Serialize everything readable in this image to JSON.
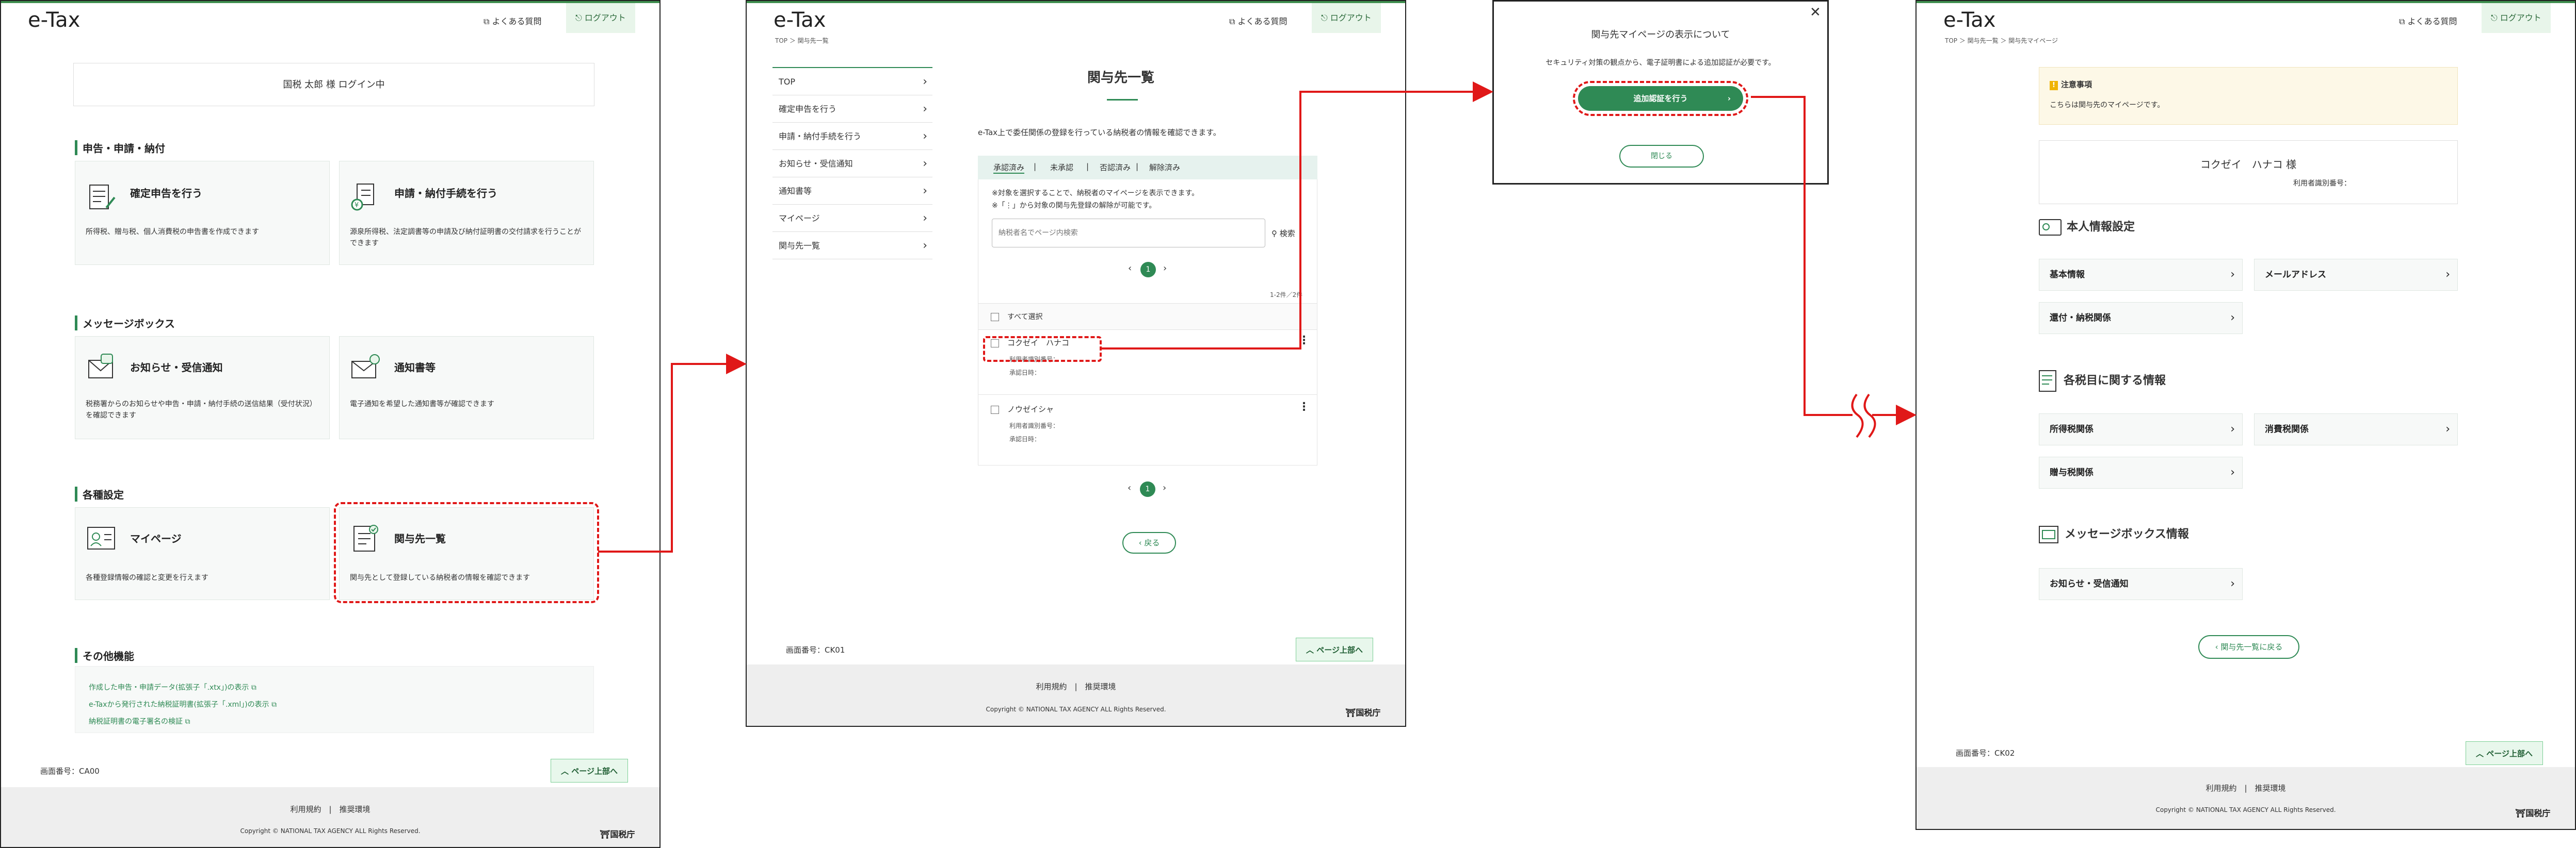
{
  "colors": {
    "accent": "#2f8a55",
    "arrow": "#e01818",
    "brand_top": "#3f8f4f"
  },
  "common": {
    "logo": "e-Tax",
    "faq": "よくある質問",
    "logout": "ログアウト",
    "footer_terms": "利用規約",
    "footer_sep": "|",
    "footer_env": "推奨環境",
    "copyright": "Copyright © NATIONAL TAX AGENCY ALL Rights Reserved.",
    "agency": "国税庁",
    "page_top": "ページ上部へ"
  },
  "screen1": {
    "login_user": "国税 太郎 様 ログイン中",
    "sec_filing": "申告・申請・納付",
    "card_kakutei_title": "確定申告を行う",
    "card_kakutei_desc": "所得税、贈与税、個人消費税の申告書を作成できます",
    "card_shinsei_title": "申請・納付手続を行う",
    "card_shinsei_desc": "源泉所得税、法定調書等の申請及び納付証明書の交付請求を行うことができます",
    "sec_message": "メッセージボックス",
    "card_oshirase_title": "お知らせ・受信通知",
    "card_oshirase_desc": "税務署からのお知らせや申告・申請・納付手続の送信結果（受付状況）を確認できます",
    "card_tsuchi_title": "通知書等",
    "card_tsuchi_desc": "電子通知を希望した通知書等が確認できます",
    "sec_settings": "各種設定",
    "card_mypage_title": "マイページ",
    "card_mypage_desc": "各種登録情報の確認と変更を行えます",
    "card_kanyo_title": "関与先一覧",
    "card_kanyo_desc": "関与先として登録している納税者の情報を確認できます",
    "sec_other": "その他機能",
    "link1": "作成した申告・申請データ(拡張子「.xtx」)の表示",
    "link2": "e-Taxから発行された納税証明書(拡張子「.xml」)の表示",
    "link3": "納税証明書の電子署名の検証",
    "screen_no": "画面番号：CA00"
  },
  "screen2": {
    "breadcrumb": "TOP ＞ 関与先一覧",
    "nav": [
      "TOP",
      "確定申告を行う",
      "申請・納付手続を行う",
      "お知らせ・受信通知",
      "通知書等",
      "マイページ",
      "関与先一覧"
    ],
    "title": "関与先一覧",
    "intro": "e-Tax上で委任関係の登録を行っている納税者の情報を確認できます。",
    "tabs": [
      "承認済み",
      "未承認",
      "否認済み",
      "解除済み"
    ],
    "note1": "※対象を選択することで、納税者のマイページを表示できます。",
    "note2": "※「⋮」から対象の関与先登録の解除が可能です。",
    "search_placeholder": "納税者名でページ内検索",
    "search_label": "検索",
    "page_current": "1",
    "count": "1-2件／2件",
    "select_all": "すべて選択",
    "rows": [
      {
        "name": "コクゼイ　ハナコ",
        "id_label": "利用者識別番号：",
        "date_label": "承認日時："
      },
      {
        "name": "ノウゼイシャ",
        "id_label": "利用者識別番号：",
        "date_label": "承認日時："
      }
    ],
    "back": "戻る",
    "screen_no": "画面番号：CK01"
  },
  "modal": {
    "title": "関与先マイページの表示について",
    "message": "セキュリティ対策の観点から、電子証明書による追加認証が必要です。",
    "primary": "追加認証を行う",
    "close": "閉じる"
  },
  "screen4": {
    "breadcrumb": "TOP ＞ 関与先一覧 ＞ 関与先マイページ",
    "notice_title": "注意事項",
    "notice_text": "こちらは関与先のマイページです。",
    "client_name": "コクゼイ　ハナコ 様",
    "client_id_label": "利用者識別番号：",
    "sec_personal": "本人情報設定",
    "btn_basic": "基本情報",
    "btn_mail": "メールアドレス",
    "btn_refund": "還付・納税関係",
    "sec_taxes": "各税目に関する情報",
    "btn_income": "所得税関係",
    "btn_consumption": "消費税関係",
    "btn_gift": "贈与税関係",
    "sec_msgbox": "メッセージボックス情報",
    "btn_oshirase": "お知らせ・受信通知",
    "back": "関与先一覧に戻る",
    "screen_no": "画面番号：CK02"
  }
}
